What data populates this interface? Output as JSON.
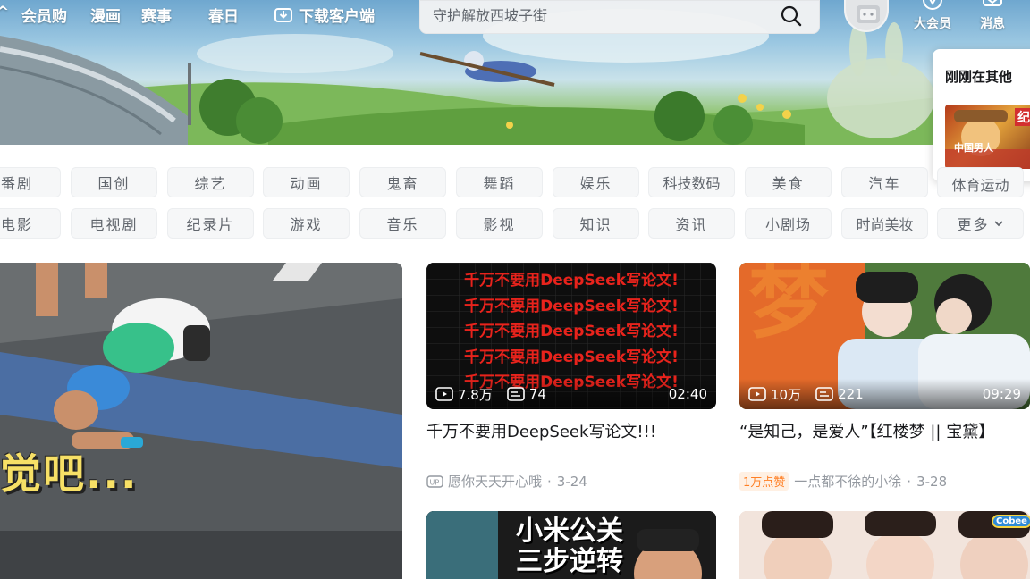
{
  "nav": {
    "items": [
      "会员购",
      "漫画",
      "赛事",
      "春日"
    ],
    "download_label": "下载客户端"
  },
  "search": {
    "placeholder": "守护解放西坡子街"
  },
  "header_right": {
    "vip_label": "大会员",
    "message_label": "消息"
  },
  "popup": {
    "title": "刚刚在其他",
    "thumb_text_1": "纪",
    "thumb_text_2": "中国男人"
  },
  "categories": {
    "row1": [
      "番剧",
      "国创",
      "综艺",
      "动画",
      "鬼畜",
      "舞蹈",
      "娱乐",
      "科技数码",
      "美食",
      "汽车",
      "体育运动"
    ],
    "row2": [
      "电影",
      "电视剧",
      "纪录片",
      "游戏",
      "音乐",
      "影视",
      "知识",
      "资讯",
      "小剧场",
      "时尚美妆",
      "更多"
    ]
  },
  "feed": {
    "big_card": {
      "overlay_text": "觉吧..."
    },
    "cards": [
      {
        "cover_lines": [
          "千万不要用DeepSeek写论文!",
          "千万不要用DeepSeek写论文!",
          "千万不要用DeepSeek写论文!",
          "千万不要用DeepSeek写论文!",
          "千万不要用DeepSeek写论文!"
        ],
        "views": "7.8万",
        "comments": "74",
        "duration": "02:40",
        "title": "千万不要用DeepSeek写论文!!!",
        "author": "愿你天天开心哦",
        "date": "3-24"
      },
      {
        "cover_char": "梦",
        "views": "10万",
        "comments": "221",
        "duration": "09:29",
        "title": "“是知己，是爱人”【红楼梦 || 宝黛】",
        "badge": "1万点赞",
        "author": "一点都不徐的小徐",
        "date": "3-28"
      }
    ],
    "row2_cards": [
      {
        "cover_line1": "小米公关",
        "cover_line2": "三步逆转"
      },
      {
        "cover_badge": "Cobee"
      }
    ]
  }
}
